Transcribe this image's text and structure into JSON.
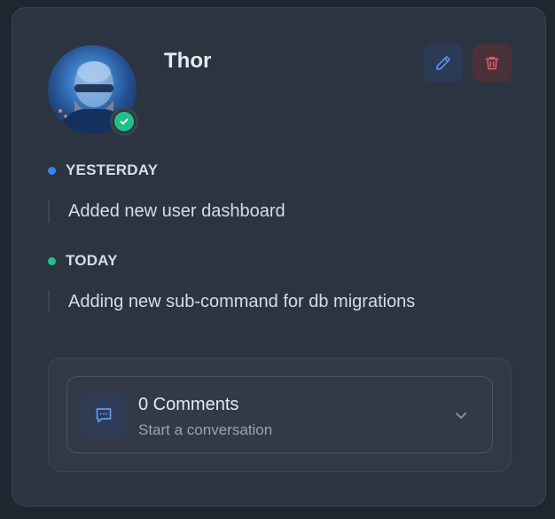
{
  "user": {
    "name": "Thor",
    "status": "online"
  },
  "actions": {
    "edit_icon": "pencil-icon",
    "delete_icon": "trash-icon"
  },
  "timeline": [
    {
      "label": "YESTERDAY",
      "text": "Added new user dashboard",
      "color": "#3b82f6"
    },
    {
      "label": "TODAY",
      "text": "Adding new sub-command for db migrations",
      "color": "#22c088"
    }
  ],
  "comments": {
    "count_label": "0 Comments",
    "subtitle": "Start a conversation",
    "icon": "chat-bubble-icon",
    "toggle_icon": "chevron-down-icon"
  },
  "colors": {
    "accent_blue": "#3b82f6",
    "accent_green": "#22c088",
    "danger": "#e35d6a",
    "card_bg": "#2d3441"
  }
}
